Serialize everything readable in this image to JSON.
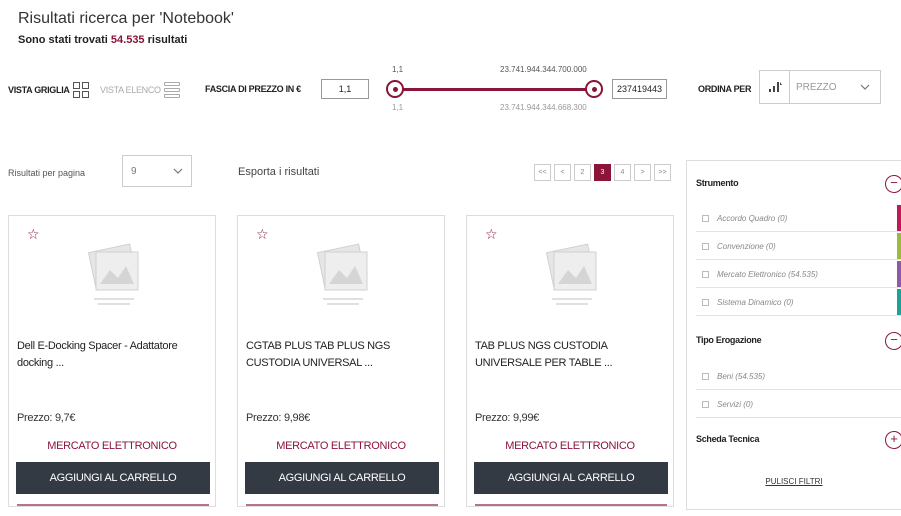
{
  "header": {
    "title": "Risultati ricerca per 'Notebook'",
    "count_prefix": "Sono stati trovati",
    "count_value": "54.535",
    "count_suffix": "risultati"
  },
  "toolbar": {
    "view_grid_label": "VISTA GRIGLIA",
    "view_list_label": "VISTA ELENCO",
    "price_label": "FASCIA DI PREZZO IN €",
    "price_min_value": "1,1",
    "price_max_value": "237419443",
    "slider_min_top": "1,1",
    "slider_max_top": "23.741.944.344.700.000",
    "slider_min_bottom": "1,1",
    "slider_max_bottom": "23.741.944.344.668.300",
    "sort_label": "ORDINA PER",
    "sort_value": "PREZZO",
    "sort_icon": "sort-ascending-icon"
  },
  "results_bar": {
    "per_page_label": "Risultati per pagina",
    "per_page_value": "9",
    "export_label": "Esporta i risultati",
    "pages": [
      "<<",
      "<",
      "2",
      "3",
      "4",
      ">",
      ">>"
    ],
    "active_page": "3"
  },
  "products": [
    {
      "name": "Dell E-Docking Spacer - Adattatore docking ...",
      "price": "Prezzo: 9,7€",
      "channel": "MERCATO ELETTRONICO",
      "button": "AGGIUNGI AL CARRELLO"
    },
    {
      "name": "CGTAB PLUS TAB PLUS NGS CUSTODIA UNIVERSAL ...",
      "price": "Prezzo: 9,98€",
      "channel": "MERCATO ELETTRONICO",
      "button": "AGGIUNGI AL CARRELLO"
    },
    {
      "name": "TAB PLUS NGS CUSTODIA UNIVERSALE PER TABLE ...",
      "price": "Prezzo: 9,99€",
      "channel": "MERCATO ELETTRONICO",
      "button": "AGGIUNGI AL CARRELLO"
    }
  ],
  "filters": {
    "strumento": {
      "title": "Strumento",
      "items": [
        {
          "label": "Accordo Quadro (0)",
          "color": "#c2185b"
        },
        {
          "label": "Convenzione (0)",
          "color": "#9bbb3c"
        },
        {
          "label": "Mercato Elettronico (54.535)",
          "color": "#8e5aa8"
        },
        {
          "label": "Sistema Dinamico (0)",
          "color": "#1aa39a"
        }
      ]
    },
    "tipo_erogazione": {
      "title": "Tipo Erogazione",
      "items": [
        {
          "label": "Beni (54.535)"
        },
        {
          "label": "Servizi (0)"
        }
      ]
    },
    "scheda_tecnica": {
      "title": "Scheda Tecnica"
    },
    "clear_label": "PULISCI FILTRI"
  },
  "colors": {
    "accent": "#8a1538",
    "button_bg": "#333a44"
  }
}
